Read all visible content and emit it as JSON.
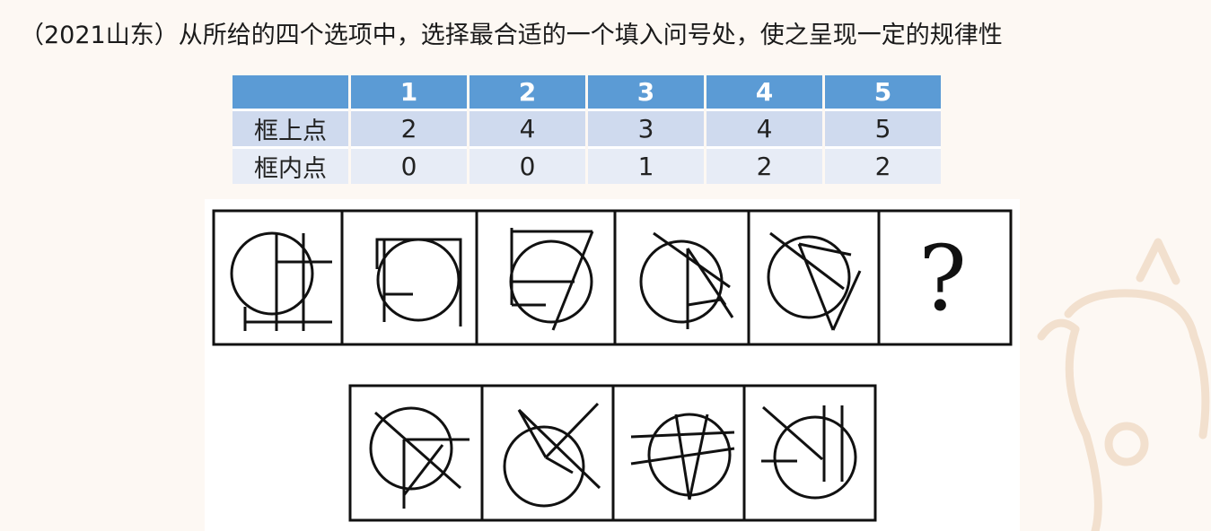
{
  "question": "（2021山东）从所给的四个选项中，选择最合适的一个填入问号处，使之呈现一定的规律性",
  "table": {
    "header": [
      "",
      "1",
      "2",
      "3",
      "4",
      "5"
    ],
    "rows": [
      {
        "label": "框上点",
        "values": [
          "2",
          "4",
          "3",
          "4",
          "5"
        ]
      },
      {
        "label": "框内点",
        "values": [
          "0",
          "0",
          "1",
          "2",
          "2"
        ]
      }
    ]
  },
  "puzzle": {
    "question_mark": "?",
    "sequence_panels": [
      "figure-1",
      "figure-2",
      "figure-3",
      "figure-4",
      "figure-5",
      "question-panel"
    ],
    "option_panels": [
      "option-a",
      "option-b",
      "option-c",
      "option-d"
    ]
  }
}
